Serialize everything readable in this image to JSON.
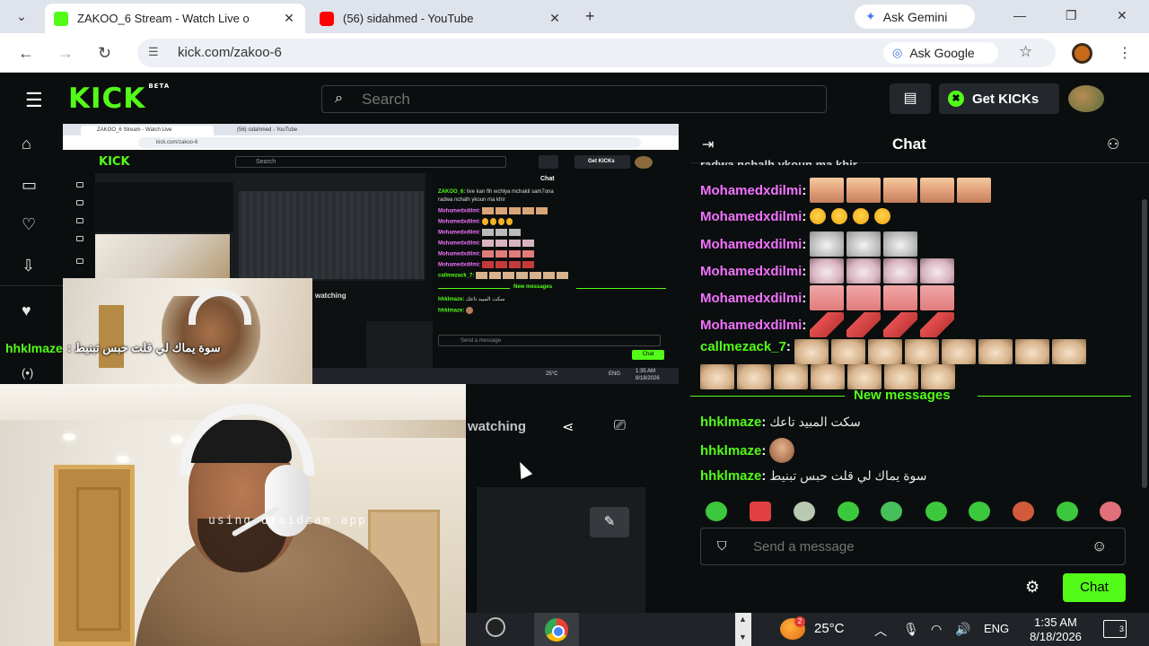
{
  "browser": {
    "tabs": [
      {
        "title": "ZAKOO_6 Stream - Watch Live o",
        "favicon": "kick-icon",
        "active": true
      },
      {
        "title": "(56) sidahmed - YouTube",
        "favicon": "youtube-icon",
        "active": false
      }
    ],
    "ask_gemini": "Ask Gemini",
    "url": "kick.com/zakoo-6",
    "ask_google": "Ask Google"
  },
  "kick": {
    "logo": "KICK",
    "logo_badge": "BETA",
    "search_placeholder": "Search",
    "get_kicks": "Get KICKs",
    "accent": "#53fc18"
  },
  "nested": {
    "tab1": "ZAKOO_6 Stream - Watch Live",
    "tab2": "(56) sidahmed - YouTube",
    "url": "kick.com/zakoo-6",
    "logo": "KICK",
    "search": "Search",
    "get_kicks": "Get KICKs",
    "chat_title": "Chat",
    "watching": "watching",
    "input_placeholder": "Send a message",
    "chat_button": "Chat",
    "temp": "25°C",
    "lang": "ENG",
    "time": "1:35 AM",
    "date": "8/18/2026",
    "lines": [
      {
        "user": "ZAKOO_6:",
        "text": "live kan fih wchlya mchakil sam7ona"
      },
      {
        "user": "",
        "text": "radwa nchalh ykoun ma khir"
      },
      {
        "user": "Mohamedxdilmi:",
        "text": ""
      },
      {
        "user": "Mohamedxdilmi:",
        "text": ""
      },
      {
        "user": "Mohamedxdilmi:",
        "text": ""
      },
      {
        "user": "Mohamedxdilmi:",
        "text": ""
      },
      {
        "user": "Mohamedxdilmi:",
        "text": ""
      },
      {
        "user": "Mohamedxdilmi:",
        "text": ""
      },
      {
        "user": "callmezack_7:",
        "text": ""
      },
      {
        "user": "hhklmaze:",
        "text": "سكت المبيد تاعك"
      },
      {
        "user": "hhklmaze:",
        "text": ""
      }
    ],
    "new_messages": "New messages"
  },
  "overlay": {
    "user": "hhklmaze",
    "text": ": سوة يماك لي قلت حبس تبنيط"
  },
  "webcam": {
    "watermark": "using droidcam app"
  },
  "stream": {
    "watching": "watching"
  },
  "chat": {
    "title": "Chat",
    "cut_line": "radwa nchalh ykoun ma khir",
    "messages": [
      {
        "user": "Mohamedxdilmi",
        "color": "#f472ff",
        "emotes": "face",
        "count": 5
      },
      {
        "user": "Mohamedxdilmi",
        "color": "#f472ff",
        "emotes": "laugh",
        "count": 4
      },
      {
        "user": "Mohamedxdilmi",
        "color": "#f472ff",
        "emotes": "cat",
        "count": 3
      },
      {
        "user": "Mohamedxdilmi",
        "color": "#f472ff",
        "emotes": "cat2",
        "count": 4
      },
      {
        "user": "Mohamedxdilmi",
        "color": "#f472ff",
        "emotes": "pink",
        "count": 4
      },
      {
        "user": "Mohamedxdilmi",
        "color": "#f472ff",
        "emotes": "fish",
        "count": 4
      },
      {
        "user": "callmezack_7",
        "color": "#53fc18",
        "emotes": "catsmall",
        "count": 15
      }
    ],
    "new_messages": "New messages",
    "new": [
      {
        "user": "hhklmaze",
        "text": "سكت المبيد تاعك"
      },
      {
        "user": "hhklmaze",
        "text": ""
      },
      {
        "user": "hhklmaze",
        "text": "سوة يماك لي قلت حبس تبنيط"
      }
    ],
    "input_placeholder": "Send a message",
    "send_label": "Chat"
  },
  "taskbar": {
    "weather_badge": "2",
    "temperature": "25°C",
    "language": "ENG",
    "time": "1:35 AM",
    "date": "8/18/2026",
    "notifications": "3"
  }
}
